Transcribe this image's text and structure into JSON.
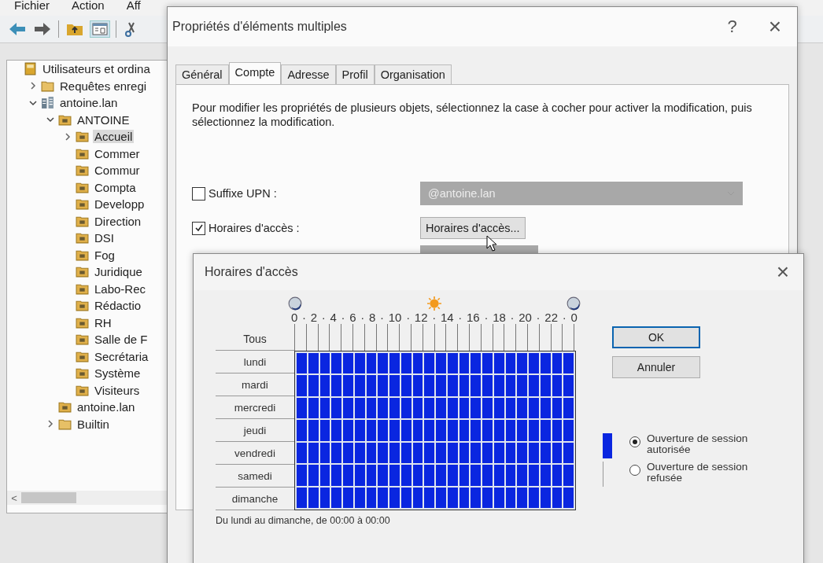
{
  "console": {
    "menu": [
      "Fichier",
      "Action",
      "Aff"
    ],
    "tree": [
      {
        "label": "Utilisateurs et ordina",
        "kind": "root",
        "selected": false,
        "children": [
          {
            "label": "Requêtes enregi",
            "kind": "folder",
            "expanded": false,
            "selected": false
          },
          {
            "label": "antoine.lan",
            "kind": "domain",
            "expanded": true,
            "selected": false,
            "children": [
              {
                "label": "ANTOINE",
                "kind": "ou",
                "expanded": true,
                "selected": false,
                "children": [
                  {
                    "label": "Accueil",
                    "kind": "ou",
                    "expanded": false,
                    "selected": true
                  },
                  {
                    "label": "Commer",
                    "kind": "ou",
                    "selected": false
                  },
                  {
                    "label": "Commur",
                    "kind": "ou",
                    "selected": false
                  },
                  {
                    "label": "Compta",
                    "kind": "ou",
                    "selected": false
                  },
                  {
                    "label": "Developp",
                    "kind": "ou",
                    "selected": false
                  },
                  {
                    "label": "Direction",
                    "kind": "ou",
                    "selected": false
                  },
                  {
                    "label": "DSI",
                    "kind": "ou",
                    "selected": false
                  },
                  {
                    "label": "Fog",
                    "kind": "ou",
                    "selected": false
                  },
                  {
                    "label": "Juridique",
                    "kind": "ou",
                    "selected": false
                  },
                  {
                    "label": "Labo-Rec",
                    "kind": "ou",
                    "selected": false
                  },
                  {
                    "label": "Rédactio",
                    "kind": "ou",
                    "selected": false
                  },
                  {
                    "label": "RH",
                    "kind": "ou",
                    "selected": false
                  },
                  {
                    "label": "Salle de F",
                    "kind": "ou",
                    "selected": false
                  },
                  {
                    "label": "Secrétaria",
                    "kind": "ou",
                    "selected": false
                  },
                  {
                    "label": "Système",
                    "kind": "ou",
                    "selected": false
                  },
                  {
                    "label": "Visiteurs",
                    "kind": "ou",
                    "selected": false
                  }
                ]
              },
              {
                "label": "antoine.lan",
                "kind": "ou",
                "selected": false
              },
              {
                "label": "Builtin",
                "kind": "folder",
                "expanded": false,
                "selected": false
              }
            ]
          }
        ]
      }
    ],
    "scroll_left": "<"
  },
  "properties_dialog": {
    "title": "Propriétés d'éléments multiples",
    "help": "?",
    "close": "×",
    "tabs": [
      {
        "label": "Général",
        "selected": false
      },
      {
        "label": "Compte",
        "selected": true
      },
      {
        "label": "Adresse",
        "selected": false
      },
      {
        "label": "Profil",
        "selected": false
      },
      {
        "label": "Organisation",
        "selected": false
      }
    ],
    "description": "Pour modifier les propriétés de plusieurs objets, sélectionnez la case à cocher pour activer la modification, puis sélectionnez la modification.",
    "rows": [
      {
        "kind": "dropdown",
        "label": "Suffixe UPN :",
        "checked": false,
        "value": "@antoine.lan"
      },
      {
        "kind": "button",
        "label": "Horaires d'accès :",
        "checked": true,
        "value": "Horaires d'accès..."
      }
    ]
  },
  "hours_dialog": {
    "title": "Horaires d'accès",
    "close": "×",
    "all": "Tous",
    "separator": "·",
    "hour_labels": [
      "0",
      "2",
      "4",
      "6",
      "8",
      "10",
      "12",
      "14",
      "16",
      "18",
      "20",
      "22",
      "0"
    ],
    "days": [
      {
        "name": "lundi",
        "hours": [
          true,
          true,
          true,
          true,
          true,
          true,
          true,
          true,
          true,
          true,
          true,
          true,
          true,
          true,
          true,
          true,
          true,
          true,
          true,
          true,
          true,
          true,
          true,
          true
        ]
      },
      {
        "name": "mardi",
        "hours": [
          true,
          true,
          true,
          true,
          true,
          true,
          true,
          true,
          true,
          true,
          true,
          true,
          true,
          true,
          true,
          true,
          true,
          true,
          true,
          true,
          true,
          true,
          true,
          true
        ]
      },
      {
        "name": "mercredi",
        "hours": [
          true,
          true,
          true,
          true,
          true,
          true,
          true,
          true,
          true,
          true,
          true,
          true,
          true,
          true,
          true,
          true,
          true,
          true,
          true,
          true,
          true,
          true,
          true,
          true
        ]
      },
      {
        "name": "jeudi",
        "hours": [
          true,
          true,
          true,
          true,
          true,
          true,
          true,
          true,
          true,
          true,
          true,
          true,
          true,
          true,
          true,
          true,
          true,
          true,
          true,
          true,
          true,
          true,
          true,
          true
        ]
      },
      {
        "name": "vendredi",
        "hours": [
          true,
          true,
          true,
          true,
          true,
          true,
          true,
          true,
          true,
          true,
          true,
          true,
          true,
          true,
          true,
          true,
          true,
          true,
          true,
          true,
          true,
          true,
          true,
          true
        ]
      },
      {
        "name": "samedi",
        "hours": [
          true,
          true,
          true,
          true,
          true,
          true,
          true,
          true,
          true,
          true,
          true,
          true,
          true,
          true,
          true,
          true,
          true,
          true,
          true,
          true,
          true,
          true,
          true,
          true
        ]
      },
      {
        "name": "dimanche",
        "hours": [
          true,
          true,
          true,
          true,
          true,
          true,
          true,
          true,
          true,
          true,
          true,
          true,
          true,
          true,
          true,
          true,
          true,
          true,
          true,
          true,
          true,
          true,
          true,
          true
        ]
      }
    ],
    "summary": "Du lundi au dimanche, de 00:00 à 00:00",
    "buttons": [
      {
        "label": "OK",
        "kind": "default"
      },
      {
        "label": "Annuler",
        "kind": "normal"
      }
    ],
    "options": [
      {
        "label": "Ouverture de session autorisée",
        "kind": "allowed",
        "selected": true
      },
      {
        "label": "Ouverture de session refusée",
        "kind": "denied",
        "selected": false
      }
    ]
  }
}
